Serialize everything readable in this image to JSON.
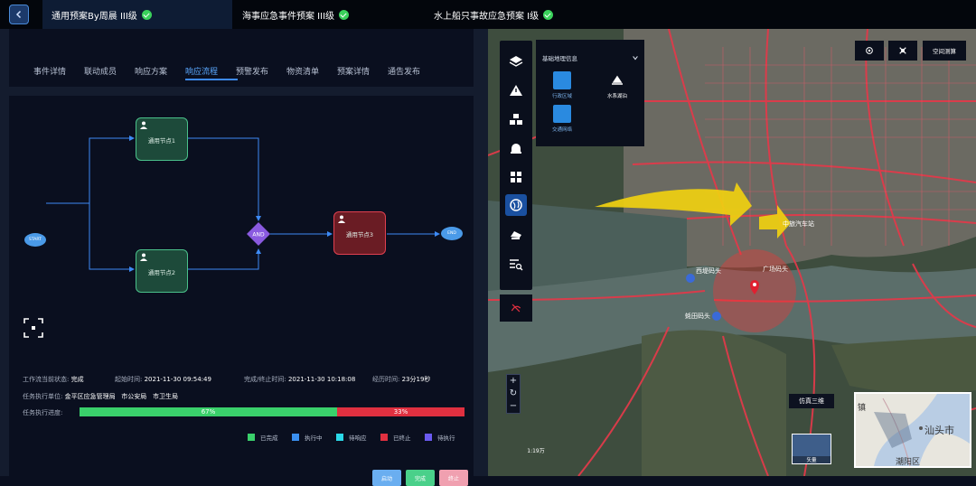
{
  "topbar": {
    "tabs": [
      {
        "label": "通用预案By周晨 III级",
        "active": true
      },
      {
        "label": "海事应急事件预案 III级",
        "active": false
      },
      {
        "label": "水上船只事故应急预案 I级",
        "active": false
      }
    ]
  },
  "subtabs": [
    "事件详情",
    "联动成员",
    "响应方案",
    "响应流程",
    "预警发布",
    "物资清单",
    "预案详情",
    "通告发布"
  ],
  "flow": {
    "start": "START",
    "end": "END",
    "and": "AND",
    "nodes": [
      "通用节点1",
      "通用节点2",
      "通用节点3"
    ]
  },
  "info": {
    "status_label": "工作流当前状态:",
    "status_value": "完成",
    "start_label": "起始时间:",
    "start_value": "2021-11-30 09:54:49",
    "finish_label": "完成/终止时间:",
    "finish_value": "2021-11-30 10:18:08",
    "elapsed_label": "经历时间:",
    "elapsed_value": "23分19秒",
    "units_label": "任务执行单位:",
    "units": [
      "金平区应急管理局",
      "市公安局",
      "市卫生局"
    ],
    "progress_label": "任务执行进度:"
  },
  "progress": {
    "complete_pct": 67,
    "complete_text": "67%",
    "terminated_pct": 33,
    "terminated_text": "33%"
  },
  "legend": [
    {
      "label": "已完成",
      "color": "#3ad06b"
    },
    {
      "label": "执行中",
      "color": "#3a8ff0"
    },
    {
      "label": "待响应",
      "color": "#2ad8e8"
    },
    {
      "label": "已终止",
      "color": "#e03040"
    },
    {
      "label": "待执行",
      "color": "#6a5af0"
    }
  ],
  "buttons": [
    {
      "label": "启动",
      "color": "#6aaef0"
    },
    {
      "label": "完成",
      "color": "#4ad08a"
    },
    {
      "label": "终止",
      "color": "#f0a0b0"
    }
  ],
  "map": {
    "geo_panel": {
      "title": "基础地理信息",
      "items": [
        "行政区域",
        "水系湖泊",
        "交通网络"
      ]
    },
    "right_buttons": [
      {
        "icon": "target-icon"
      },
      {
        "icon": "layers-cross-icon"
      },
      {
        "label": "空间测算"
      }
    ],
    "labels": {
      "bus_station": "中旅汽车站",
      "guangchang": "广场码头",
      "xidi": "西堤码头",
      "zuantian": "蚝田码头",
      "shantou": "汕头市",
      "chaoyang": "潮阳区",
      "town": "镇"
    },
    "scale": "1:19万",
    "sim3d": "仿真三维",
    "thumb_label": "矢量"
  },
  "colors": {
    "accent": "#3d8af5",
    "complete": "#3ad06b",
    "terminated": "#e03040",
    "node_green": "#1d4a3a",
    "node_red": "#6a1c24"
  }
}
